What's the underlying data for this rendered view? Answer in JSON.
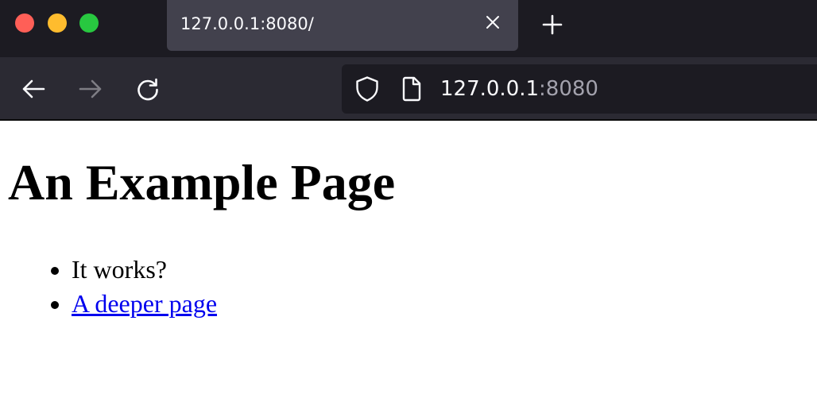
{
  "browser": {
    "tab": {
      "title": "127.0.0.1:8080/"
    },
    "address_bar": {
      "host": "127.0.0.1",
      "port": ":8080"
    },
    "colors": {
      "tabbar_bg": "#1c1b22",
      "active_tab_bg": "#42414d",
      "toolbar_bg": "#2b2a33",
      "urlbar_bg": "#1c1b22",
      "close_button": "#ff5f57",
      "minimize_button": "#febc2e",
      "zoom_button": "#28c840"
    },
    "icons": [
      "close-window",
      "minimize-window",
      "zoom-window",
      "tab-close-icon",
      "new-tab-icon",
      "back-arrow-icon",
      "forward-arrow-icon",
      "reload-icon",
      "shield-icon",
      "page-icon"
    ]
  },
  "page": {
    "heading": "An Example Page",
    "list": [
      {
        "text": "It works?"
      },
      {
        "text": "A deeper page"
      }
    ],
    "link_color": "#0000ee"
  }
}
